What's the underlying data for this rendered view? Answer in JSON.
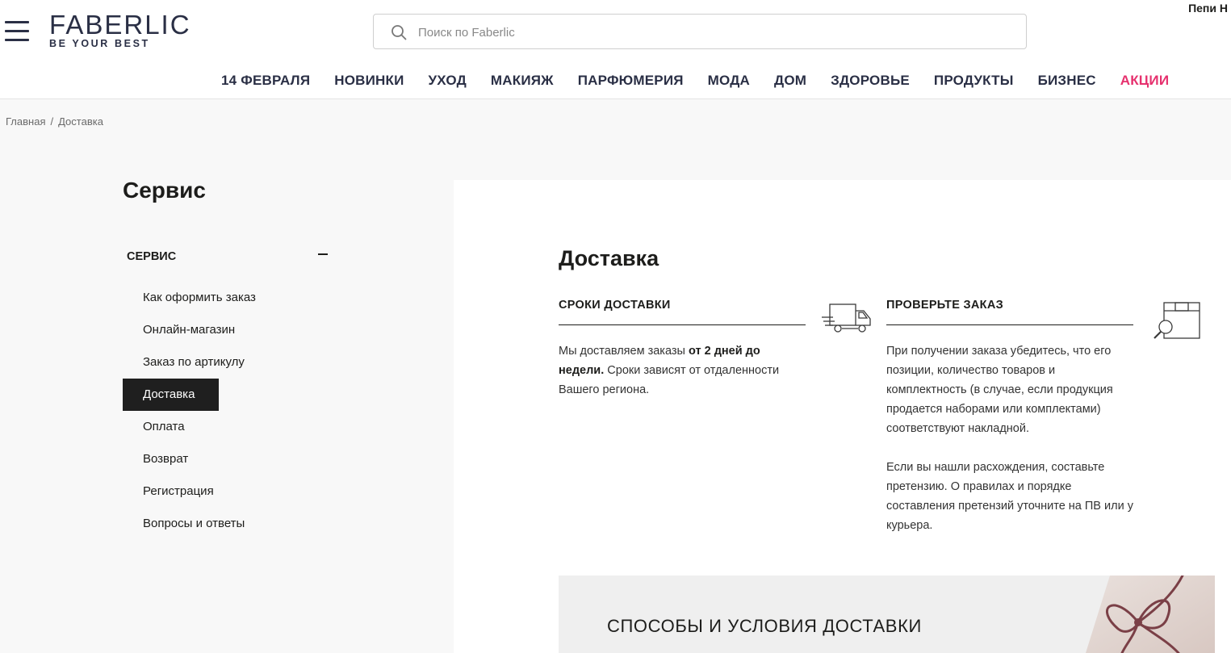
{
  "header": {
    "logo_main": "FABERLIC",
    "logo_sub": "BE YOUR BEST",
    "search_placeholder": "Поиск по Faberlic",
    "user_name": "Пепи Н"
  },
  "nav": {
    "items": [
      "14 ФЕВРАЛЯ",
      "НОВИНКИ",
      "УХОД",
      "МАКИЯЖ",
      "ПАРФЮМЕРИЯ",
      "МОДА",
      "ДОМ",
      "ЗДОРОВЬЕ",
      "ПРОДУКТЫ",
      "БИЗНЕС"
    ],
    "promo": "АКЦИИ",
    "promo_color": "#e6316e"
  },
  "breadcrumb": {
    "home": "Главная",
    "separator": "/",
    "current": "Доставка"
  },
  "sidebar": {
    "title": "Сервис",
    "section": "СЕРВИС",
    "items": [
      "Как оформить заказ",
      "Онлайн-магазин",
      "Заказ по артикулу",
      "Доставка",
      "Оплата",
      "Возврат",
      "Регистрация",
      "Вопросы и ответы"
    ],
    "active_item": "Доставка"
  },
  "content": {
    "title": "Доставка",
    "delivery_terms": {
      "heading": "СРОКИ ДОСТАВКИ",
      "text_before": "Мы доставляем заказы ",
      "text_bold": "от 2 дней до недели.",
      "text_after": " Сроки зависят от отдаленности Вашего региона.",
      "icon": "truck-icon"
    },
    "check_order": {
      "heading": "ПРОВЕРЬТЕ ЗАКАЗ",
      "text1": "При получении заказа убедитесь, что его позиции, количество товаров и комплектность (в случае, если продукция продается наборами или комплектами) соответствуют накладной.",
      "text2": "Если вы нашли расхождения, составьте претензию. О правилах и порядке составления претензий уточните на ПВ или у курьера.",
      "icon": "box-search-icon"
    },
    "banner_title": "СПОСОБЫ И УСЛОВИЯ ДОСТАВКИ"
  }
}
